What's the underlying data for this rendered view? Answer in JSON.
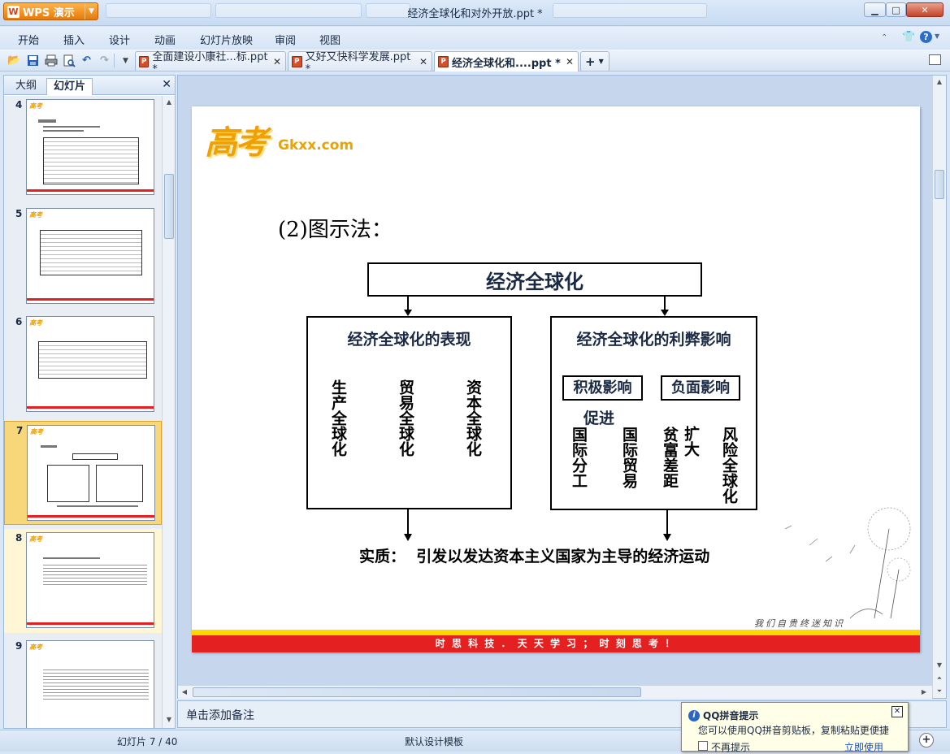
{
  "app": {
    "name": "WPS 演示",
    "window_title": "经济全球化和对外开放.ppt *"
  },
  "menu": [
    "开始",
    "插入",
    "设计",
    "动画",
    "幻灯片放映",
    "审阅",
    "视图"
  ],
  "doc_tabs": [
    {
      "label": "全面建设小康社...标.ppt *"
    },
    {
      "label": "又好又快科学发展.ppt *"
    },
    {
      "label": "经济全球化和....ppt *"
    }
  ],
  "left_panel": {
    "tabs": [
      "大纲",
      "幻灯片"
    ],
    "slide_numbers": [
      "4",
      "5",
      "6",
      "7",
      "8",
      "9"
    ],
    "thumb_logo": "高考"
  },
  "slide": {
    "logo_gaokao": "高考",
    "logo_site": "Gkxx.com",
    "heading": "(2)图示法：",
    "diagram": {
      "top": "经济全球化",
      "left_box_title": "经济全球化的表现",
      "left_items": [
        "生产全球化",
        "贸易全球化",
        "资本全球化"
      ],
      "right_box_title": "经济全球化的利弊影响",
      "positive": "积极影响",
      "negative": "负面影响",
      "promote": "促进",
      "expand": "扩大",
      "pos_items": [
        "国际分工",
        "国际贸易"
      ],
      "neg_items": [
        "贫富差距",
        "风险全球化"
      ],
      "essence": "实质：  引发以发达资本主义国家为主导的经济运动"
    },
    "signature": "我们自贵终迷知识",
    "footer_banner": "时 思 科 技 ． 天 天 学 习 ； 时 刻 思 考 ！"
  },
  "notes_placeholder": "单击添加备注",
  "status": {
    "slide_pos": "幻灯片 7 / 40",
    "template": "默认设计模板"
  },
  "popup": {
    "title": "QQ拼音提示",
    "message": "您可以使用QQ拼音剪贴板，复制粘贴更便捷",
    "dont_show": "不再提示",
    "use_now": "立即使用"
  },
  "colors": {
    "accent_red": "#e52020",
    "banner_yellow": "#ffd700",
    "logo_orange": "#f0a000",
    "selection": "#f7d77a"
  }
}
